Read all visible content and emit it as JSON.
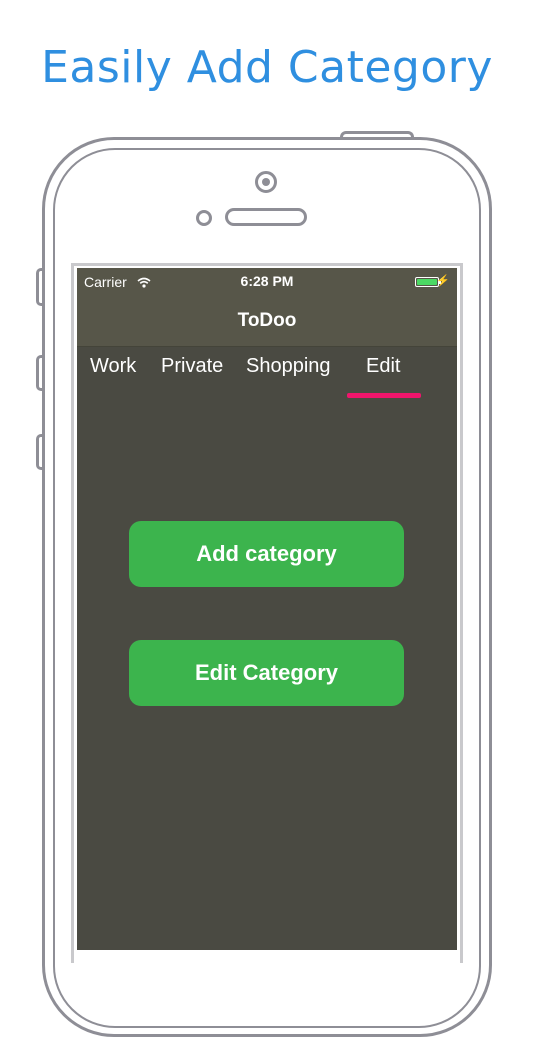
{
  "headline": "Easily Add Category",
  "status_bar": {
    "carrier": "Carrier",
    "time": "6:28 PM",
    "wifi_icon": "wifi-icon",
    "battery_icon": "battery-icon",
    "charging_icon": "bolt-icon",
    "battery_color": "#4cd964"
  },
  "nav": {
    "title": "ToDoo"
  },
  "tabs": [
    {
      "label": "Work"
    },
    {
      "label": "Private"
    },
    {
      "label": "Shopping"
    },
    {
      "label": "Edit"
    }
  ],
  "active_tab": "Edit",
  "indicator_color": "#f0156c",
  "buttons": {
    "add_label": "Add category",
    "edit_label": "Edit Category",
    "color": "#3cb44d"
  },
  "colors": {
    "headline": "#2f8fe0",
    "screen_bg": "#4a4a42",
    "bar_bg": "#575649"
  }
}
